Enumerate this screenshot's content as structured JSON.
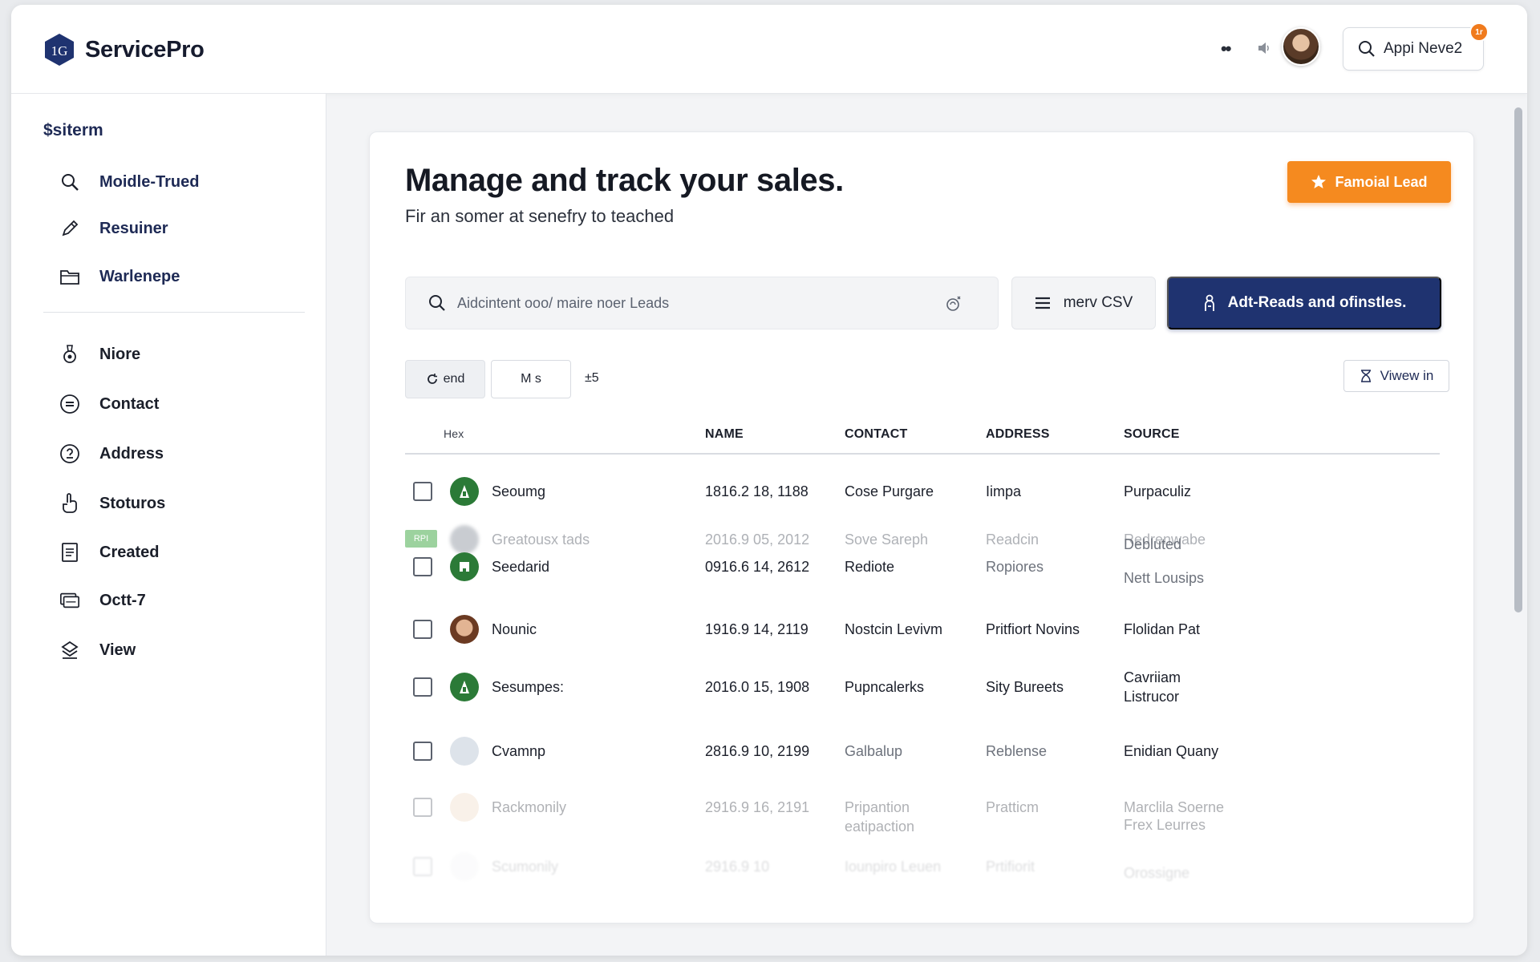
{
  "app": {
    "brand_name": "ServicePro",
    "brand_logo_text": "1G"
  },
  "header": {
    "menu_dots": "••",
    "search_label": "Appi Neve2",
    "notification_count": "1r"
  },
  "sidebar": {
    "heading": "$siterm",
    "items": [
      {
        "label": "Moidle-Trued",
        "icon": "search-icon"
      },
      {
        "label": "Resuiner",
        "icon": "pencil-icon"
      },
      {
        "label": "Warlenepe",
        "icon": "folder-icon"
      },
      {
        "label": "Niore",
        "icon": "award-icon"
      },
      {
        "label": "Contact",
        "icon": "circle-list-icon"
      },
      {
        "label": "Address",
        "icon": "circle-info-icon"
      },
      {
        "label": "Stoturos",
        "icon": "hand-icon"
      },
      {
        "label": "Created",
        "icon": "document-icon"
      },
      {
        "label": "Octt-7",
        "icon": "cards-icon"
      },
      {
        "label": "View",
        "icon": "layers-icon"
      }
    ]
  },
  "main": {
    "title": "Manage and track your sales.",
    "subtitle": "Fir an somer at senefry to teached",
    "primary_action": "Famoial Lead",
    "search_placeholder": "Aidcintent ooo/ maire noer Leads",
    "csv_button": "merv CSV",
    "navy_button": "Adt-Reads and ofinstles.",
    "chip_1": "end",
    "chip_2": "M s",
    "chip_count": "±5",
    "view_button": "Viwew in"
  },
  "table": {
    "columns": [
      "Hex",
      "NAME",
      "CONTACT",
      "ADDRESS",
      "SOURCE"
    ],
    "rows": [
      {
        "name": "Seoumg",
        "date": "1816.2 18, 1188",
        "contact": "Cose Purgare",
        "address": "Iimpa",
        "source": "Purpaculiz",
        "source2": ""
      },
      {
        "name": "Greatousx tads",
        "date": "2016.9 05, 2012",
        "contact": "Sove Sareph",
        "address": "Readcin",
        "source": "Redrenwabe",
        "source2": "",
        "tag": "RPI"
      },
      {
        "name": "Seedarid",
        "date": "0916.6 14, 2612",
        "contact": "Rediote",
        "address": "Ropiores",
        "source": "Debluted",
        "source2": "Nett Lousips"
      },
      {
        "name": "Nounic",
        "date": "1916.9 14, 2119",
        "contact": "Nostcin Levivm",
        "address": "Pritfiort Novins",
        "source": "Flolidan Pat",
        "source2": ""
      },
      {
        "name": "Sesumpes:",
        "date": "2016.0 15, 1908",
        "contact": "Pupncalerks",
        "address": "Sity Bureets",
        "source": "Cavriiam",
        "source2": "Listrucor"
      },
      {
        "name": "Cvamnp",
        "date": "2816.9 10, 2199",
        "contact": "Galbalup",
        "address": "Reblense",
        "source": "Enidian Quany",
        "source2": ""
      },
      {
        "name": "Rackmonily",
        "date": "2916.9 16, 2191",
        "contact": "Pripantion",
        "contact2": "eatipaction",
        "address": "Pratticm",
        "source": "Marclila Soerne",
        "source2": "Frex Leurres"
      },
      {
        "name": "Scumonily",
        "date": "2916.9 10",
        "contact": "Iounpiro Leuen",
        "address": "Prtifiorit",
        "source": "Orossigne",
        "source2": ""
      }
    ]
  },
  "colors": {
    "brand_navy": "#1f3370",
    "accent_orange": "#f58a1f",
    "status_green": "#2b7a37"
  }
}
